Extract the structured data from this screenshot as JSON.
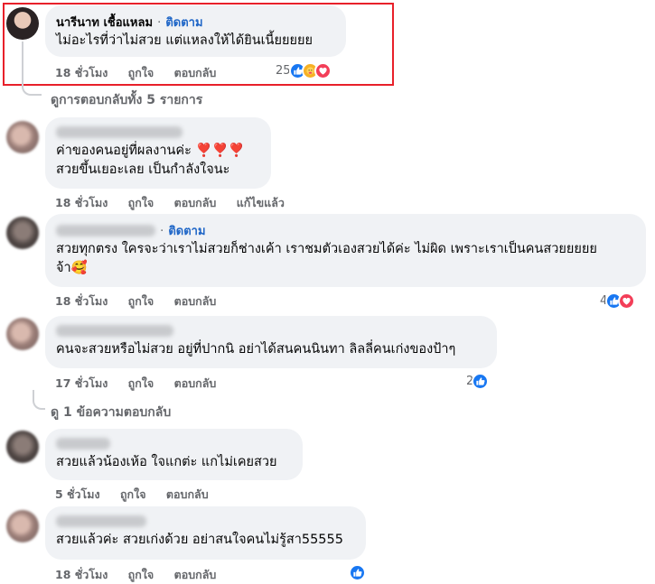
{
  "main_comment": {
    "author": "นารีนาท เชื้อแหลม",
    "follow": "ติดตาม",
    "text": "ไม่อะไรที่ว่าไม่สวย แต่แหลงให้ได้ยินเนี้ยยยยย",
    "time": "18 ชั่วโมง",
    "like": "ถูกใจ",
    "reply": "ตอบกลับ",
    "reaction_count": "25",
    "reaction_icons": [
      "like-icon",
      "care-icon",
      "love-icon"
    ]
  },
  "view_all_replies": "ดูการตอบกลับทั้ง 5 รายการ",
  "replies": [
    {
      "author_blurred": true,
      "lines": [
        "ค่าของคนอยู่ที่ผลงานค่ะ ❣️❣️❣️",
        "สวยขึ้นเยอะเลย เป็นกำลังใจนะ"
      ],
      "time": "18 ชั่วโมง",
      "like": "ถูกใจ",
      "reply": "ตอบกลับ",
      "edited": "แก้ไขแล้ว"
    },
    {
      "author_blurred": true,
      "follow": "ติดตาม",
      "lines": [
        "สวยทุกตรง ใครจะว่าเราไม่สวยก็ช่างเค้า เราชมตัวเองสวยได้ค่ะ ไม่ผิด เพราะเราเป็นคนสวยยยยย",
        "จ้า🥰"
      ],
      "time": "18 ชั่วโมง",
      "like": "ถูกใจ",
      "reply": "ตอบกลับ",
      "reaction_count": "4",
      "reaction_icons": [
        "like-icon",
        "love-icon"
      ]
    },
    {
      "author_blurred": true,
      "lines": [
        "คนจะสวยหรือไม่สวย อยู่ที่ปากนิ อย่าได้สนคนนินทา ลิลลี่คนเก่งของป้าๆ"
      ],
      "time": "17 ชั่วโมง",
      "like": "ถูกใจ",
      "reply": "ตอบกลับ",
      "reaction_count": "2",
      "reaction_icons": [
        "like-icon"
      ]
    },
    {
      "author_blurred": true,
      "lines": [
        "สวยแล้วน้องเห้อ ใจแกต่ะ แกไม่เคยสวย"
      ],
      "time": "5 ชั่วโมง",
      "like": "ถูกใจ",
      "reply": "ตอบกลับ"
    },
    {
      "author_blurred": true,
      "lines": [
        "สวยแล้วค่ะ สวยเก่งด้วย อย่าสนใจคนไม่รู้สา55555"
      ],
      "time": "18 ชั่วโมง",
      "like": "ถูกใจ",
      "reply": "ตอบกลับ",
      "reaction_icons": [
        "like-icon"
      ]
    }
  ],
  "view_one_reply": "ดู 1 ข้อความตอบกลับ",
  "colors": {
    "bubble": "#f0f2f5",
    "link_blue": "#1f66c7",
    "meta_gray": "#65676b",
    "highlight_red": "#e8202a",
    "like_blue": "#1877f2",
    "love_red": "#f33e58"
  }
}
